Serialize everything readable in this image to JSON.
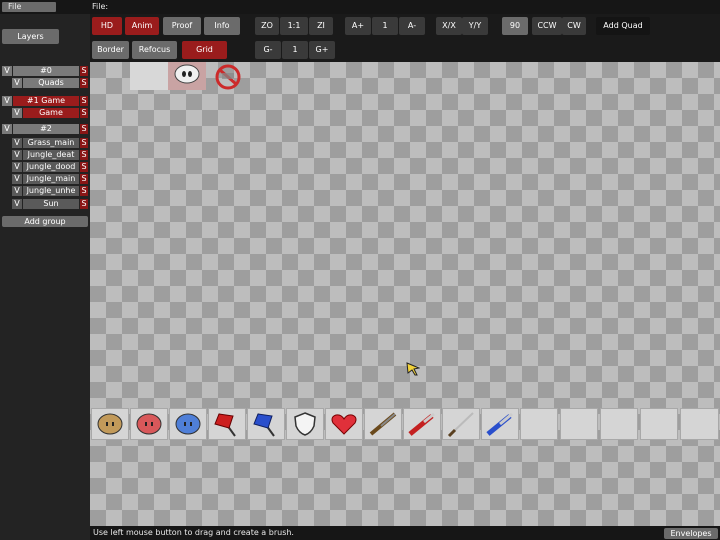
{
  "menus": {
    "file_left": "File",
    "file_main": "File:"
  },
  "left_panel": {
    "layers_label": "Layers",
    "groups": [
      {
        "vis": "V",
        "name": "#0",
        "s": "S",
        "layers": [
          {
            "vis": "V",
            "name": "Quads",
            "s": "S"
          }
        ]
      },
      {
        "vis": "V",
        "name": "#1 Game",
        "s": "S",
        "layers": [
          {
            "vis": "V",
            "name": "Game",
            "s": "S"
          }
        ]
      },
      {
        "vis": "V",
        "name": "#2",
        "s": "S",
        "layers": [
          {
            "vis": "V",
            "name": "Grass_main",
            "s": "S"
          },
          {
            "vis": "V",
            "name": "Jungle_deat",
            "s": "S"
          },
          {
            "vis": "V",
            "name": "Jungle_dood",
            "s": "S"
          },
          {
            "vis": "V",
            "name": "Jungle_main",
            "s": "S"
          },
          {
            "vis": "V",
            "name": "Jungle_unhe",
            "s": "S"
          },
          {
            "vis": "V",
            "name": "Sun",
            "s": "S"
          }
        ]
      }
    ],
    "add_group_label": "Add group"
  },
  "toolbar": {
    "row1": {
      "hd": "HD",
      "anim": "Anim",
      "proof": "Proof",
      "info": "Info",
      "zo": "ZO",
      "zoom_reset": "1:1",
      "zi": "ZI",
      "a_plus": "A+",
      "a_value": "1",
      "a_minus": "A-",
      "flip_x": "X/X",
      "flip_y": "Y/Y",
      "rot_value": "90",
      "ccw": "CCW",
      "cw": "CW",
      "add_quad": "Add Quad"
    },
    "row2": {
      "border": "Border",
      "refocus": "Refocus",
      "grid": "Grid",
      "g_minus": "G-",
      "g_value": "1",
      "g_plus": "G+"
    }
  },
  "item_strip": {
    "slots": [
      "tee-brown-icon",
      "tee-red-icon",
      "tee-blue-icon",
      "red-flag-icon",
      "blue-flag-icon",
      "armor-icon",
      "heart-icon",
      "shotgun-icon",
      "grenade-launcher-icon",
      "katana-icon",
      "laser-rifle-icon",
      "empty",
      "empty",
      "empty",
      "empty",
      "empty"
    ]
  },
  "status": {
    "text": "Use left mouse button to drag and create a brush.",
    "envelopes_label": "Envelopes"
  },
  "colors": {
    "accent_red": "#9a1c1c",
    "button_grey": "#6b6b6b",
    "panel_bg": "#232323"
  }
}
